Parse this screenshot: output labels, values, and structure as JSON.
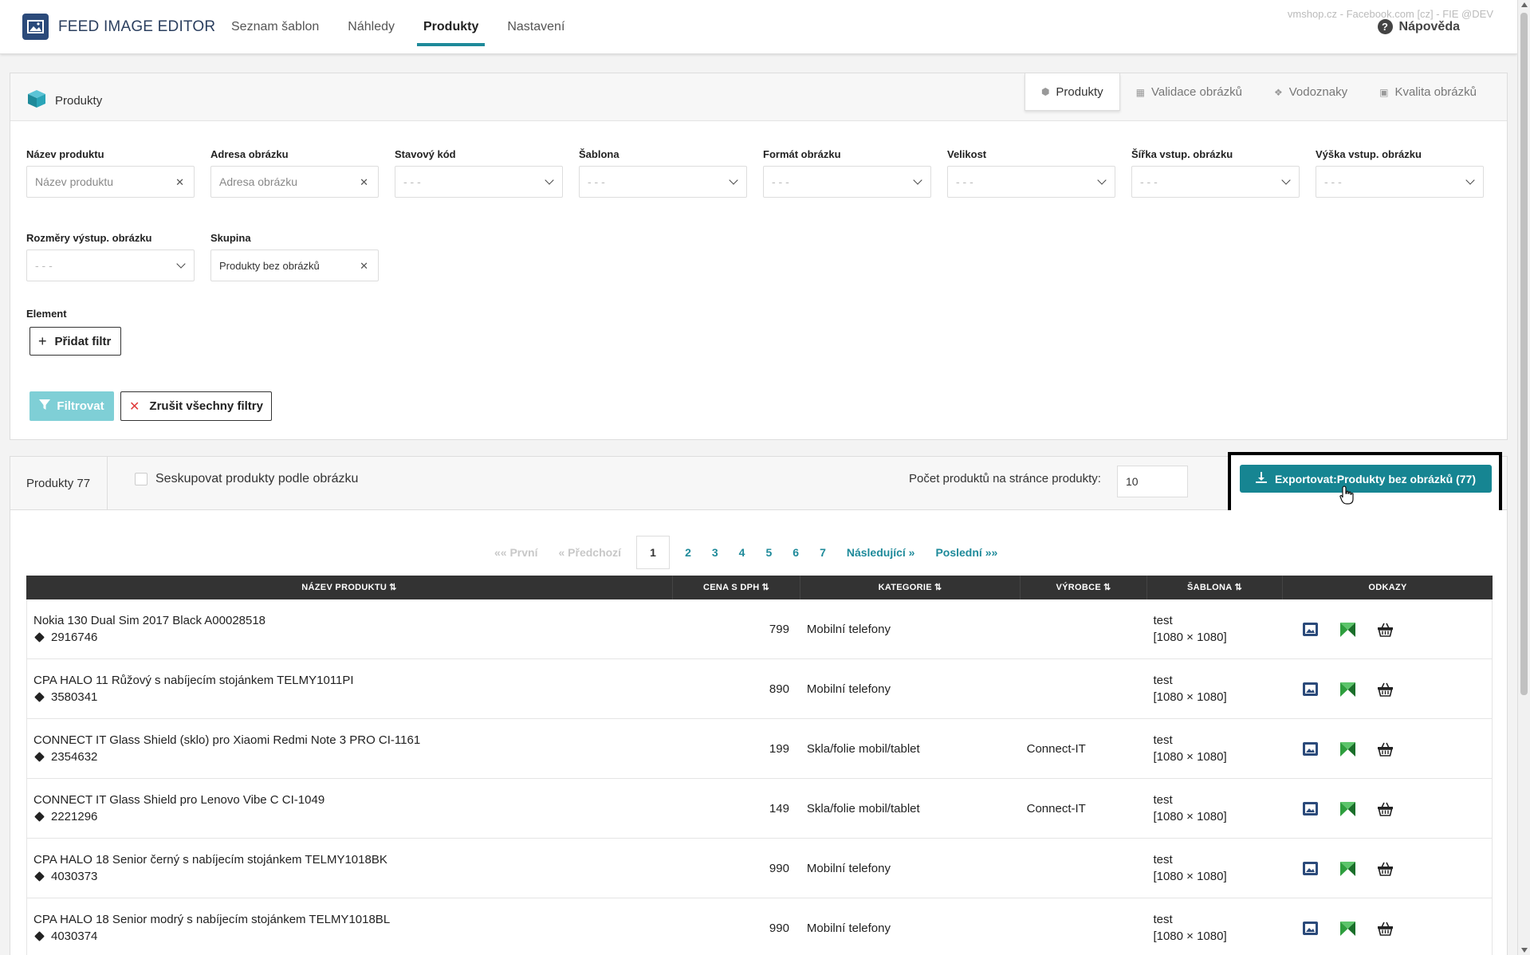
{
  "app": {
    "title": "FEED IMAGE EDITOR",
    "top_note": "vmshop.cz - Facebook.com [cz] - FIE @DEV",
    "help_label": "Nápověda"
  },
  "nav": {
    "items": [
      {
        "label": "Seznam šablon",
        "active": false
      },
      {
        "label": "Náhledy",
        "active": false
      },
      {
        "label": "Produkty",
        "active": true
      },
      {
        "label": "Nastavení",
        "active": false
      }
    ]
  },
  "filter_card": {
    "title": "Produkty",
    "tabs": [
      {
        "label": "Produkty",
        "icon": "box-icon",
        "active": true
      },
      {
        "label": "Validace obrázků",
        "icon": "grid-icon",
        "active": false
      },
      {
        "label": "Vodoznaky",
        "icon": "paw-icon",
        "active": false
      },
      {
        "label": "Kvalita obrázků",
        "icon": "image-icon",
        "active": false
      }
    ],
    "fields": {
      "product_name": {
        "label": "Název produktu",
        "placeholder": "Název produktu"
      },
      "image_url": {
        "label": "Adresa obrázku",
        "placeholder": "Adresa obrázku"
      },
      "status_code": {
        "label": "Stavový kód",
        "value": "- - -"
      },
      "template": {
        "label": "Šablona",
        "value": "- - -"
      },
      "image_format": {
        "label": "Formát obrázku",
        "value": "- - -"
      },
      "size": {
        "label": "Velikost",
        "value": "- - -"
      },
      "input_width": {
        "label": "Šířka vstup. obrázku",
        "value": "- - -"
      },
      "input_height": {
        "label": "Výška vstup. obrázku",
        "value": "- - -"
      },
      "output_dims": {
        "label": "Rozměry výstup. obrázku",
        "value": "- - -"
      },
      "group": {
        "label": "Skupina",
        "value": "Produkty bez obrázků"
      }
    },
    "element_label": "Element",
    "add_filter_label": "Přidat filtr",
    "filter_button": "Filtrovat",
    "clear_filters_button": "Zrušit všechny filtry"
  },
  "products_bar": {
    "count_label": "Produkty 77",
    "group_by_image_label": "Seskupovat produkty podle obrázku",
    "per_page_label": "Počet produktů na stránce produkty:",
    "per_page_value": "10",
    "export_button": "Exportovat:Produkty bez obrázků (77)"
  },
  "pager": {
    "first": "«« První",
    "prev": "« Předchozí",
    "pages": [
      "1",
      "2",
      "3",
      "4",
      "5",
      "6",
      "7"
    ],
    "current": "1",
    "next": "Následující »",
    "last": "Poslední »»"
  },
  "table": {
    "headers": {
      "name": "NÁZEV PRODUKTU",
      "price": "CENA S DPH",
      "category": "KATEGORIE",
      "manufacturer": "VÝROBCE",
      "template": "ŠABLONA",
      "links": "ODKAZY"
    },
    "rows": [
      {
        "name": "Nokia 130 Dual Sim 2017 Black A00028518",
        "code": "2916746",
        "price": "799",
        "category": "Mobilní telefony",
        "manufacturer": "",
        "template": "test",
        "dims": "[1080 × 1080]"
      },
      {
        "name": "CPA HALO 11 Růžový s nabíjecím stojánkem TELMY1011PI",
        "code": "3580341",
        "price": "890",
        "category": "Mobilní telefony",
        "manufacturer": "",
        "template": "test",
        "dims": "[1080 × 1080]"
      },
      {
        "name": "CONNECT IT Glass Shield (sklo) pro Xiaomi Redmi Note 3 PRO CI-1161",
        "code": "2354632",
        "price": "199",
        "category": "Skla/folie mobil/tablet",
        "manufacturer": "Connect-IT",
        "template": "test",
        "dims": "[1080 × 1080]"
      },
      {
        "name": "CONNECT IT Glass Shield pro Lenovo Vibe C CI-1049",
        "code": "2221296",
        "price": "149",
        "category": "Skla/folie mobil/tablet",
        "manufacturer": "Connect-IT",
        "template": "test",
        "dims": "[1080 × 1080]"
      },
      {
        "name": "CPA HALO 18 Senior černý s nabíjecím stojánkem TELMY1018BK",
        "code": "4030373",
        "price": "990",
        "category": "Mobilní telefony",
        "manufacturer": "",
        "template": "test",
        "dims": "[1080 × 1080]"
      },
      {
        "name": "CPA HALO 18 Senior modrý s nabíjecím stojánkem TELMY1018BL",
        "code": "4030374",
        "price": "990",
        "category": "Mobilní telefony",
        "manufacturer": "",
        "template": "test",
        "dims": "[1080 × 1080]"
      }
    ]
  },
  "colors": {
    "accent": "#1e8a9a",
    "export_button": "#168592",
    "filter_button": "#7fcfd6",
    "brand": "#2b4a7a"
  }
}
